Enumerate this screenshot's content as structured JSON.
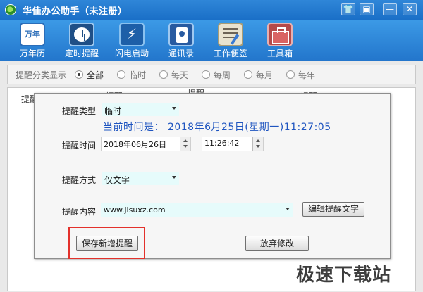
{
  "window": {
    "title": "华佳办公助手（未注册）",
    "controls": {
      "skin": "👕",
      "menu": "▣",
      "minimize": "—",
      "close": "✕"
    }
  },
  "toolbar": {
    "items": [
      {
        "label": "万年历",
        "icon": "calendar-icon",
        "icon_text": "万年历"
      },
      {
        "label": "定时提醒",
        "icon": "clock-icon"
      },
      {
        "label": "闪电启动",
        "icon": "lightning-icon",
        "icon_text": "⚡"
      },
      {
        "label": "通讯录",
        "icon": "contacts-icon"
      },
      {
        "label": "工作便签",
        "icon": "notes-icon"
      },
      {
        "label": "工具箱",
        "icon": "toolbox-icon"
      }
    ]
  },
  "filter": {
    "label": "提醒分类显示",
    "options": [
      "全部",
      "临时",
      "每天",
      "每周",
      "每月",
      "每年"
    ],
    "selected": "全部"
  },
  "table": {
    "headers": [
      "提醒",
      "提醒",
      "提醒",
      "提醒"
    ]
  },
  "dialog": {
    "type_label": "提醒类型",
    "type_value": "临时",
    "current_time": "当前时间是：  2018年6月25日(星期一)11:27:05",
    "time_label": "提醒时间",
    "date_value": "2018年06月26日",
    "time_value": "11:26:42",
    "method_label": "提醒方式",
    "method_value": "仅文字",
    "content_label": "提醒内容",
    "content_value": "www.jisuxz.com",
    "edit_button": "编辑提醒文字",
    "save_button": "保存新增提醒",
    "discard_button": "放弃修改"
  },
  "watermark": "极速下载站",
  "colors": {
    "titlebar": "#1a6fc7",
    "toolbar": "#2f86d8",
    "current_time_text": "#1f55c0",
    "highlight_box": "#e3312b",
    "input_cyan": "#e6fbfb"
  }
}
